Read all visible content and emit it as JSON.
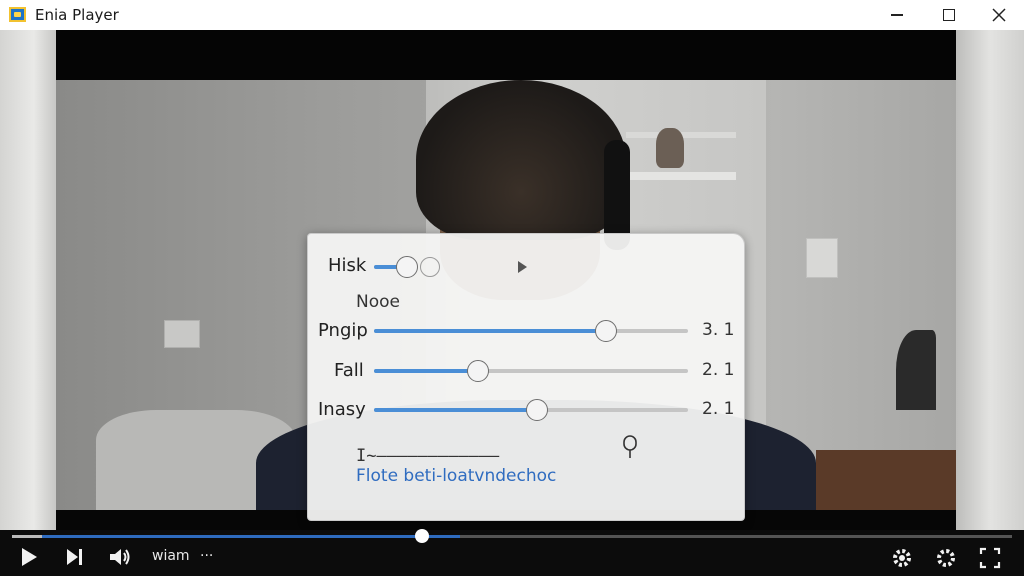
{
  "window": {
    "title": "Enia Player",
    "icon": "app-icon"
  },
  "panel": {
    "rows": [
      {
        "label": "Hisk"
      },
      {
        "label": "Nooe"
      },
      {
        "label": "Pngip",
        "value": "3. 1",
        "level": 0.74
      },
      {
        "label": "Fall",
        "value": "2. 1",
        "level": 0.33
      },
      {
        "label": "Inasy",
        "value": "2. 1",
        "level": 0.52
      }
    ],
    "dash_line": "I~————————————",
    "link": "Flote beti-loatvndechoc"
  },
  "controls": {
    "extra_label": "wiam",
    "more": "···",
    "seek_progress": 0.41,
    "buffer_progress": 0.448
  },
  "colors": {
    "accent": "#4a8ed6",
    "link": "#2f6cc0",
    "control_bar": "#0c0c0c"
  }
}
